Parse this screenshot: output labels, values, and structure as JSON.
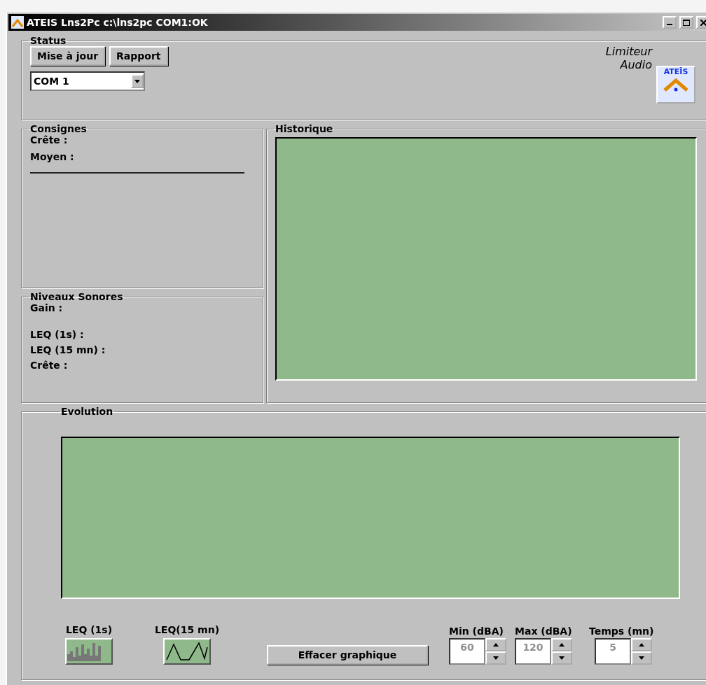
{
  "window": {
    "title": "ATEIS Lns2Pc c:\\lns2pc COM1:OK"
  },
  "status": {
    "title": "Status",
    "buttons": [
      "Mise à jour",
      "Rapport"
    ],
    "port": {
      "value": "COM 1"
    },
    "brand_lines": [
      "Limiteur",
      "Audio"
    ],
    "logo_text": "ATEÏS"
  },
  "consignes": {
    "title": "Consignes",
    "labels": [
      "Crête :",
      "Moyen :"
    ]
  },
  "niveaux": {
    "title": "Niveaux Sonores",
    "labels": [
      "Gain :",
      "LEQ (1s) :",
      "LEQ (15 mn) :",
      "Crête :"
    ]
  },
  "historique": {
    "title": "Historique"
  },
  "evolution": {
    "title": "Evolution",
    "modes": [
      {
        "label": "LEQ (1s)",
        "kind": "bars"
      },
      {
        "label": "LEQ(15 mn)",
        "kind": "wave"
      }
    ],
    "clear_button": "Effacer graphique",
    "spins": [
      {
        "label": "Min (dBA)",
        "value": "60",
        "disabled": true
      },
      {
        "label": "Max (dBA)",
        "value": "120",
        "disabled": true
      },
      {
        "label": "Temps (mn)",
        "value": "5",
        "disabled": true
      }
    ]
  }
}
